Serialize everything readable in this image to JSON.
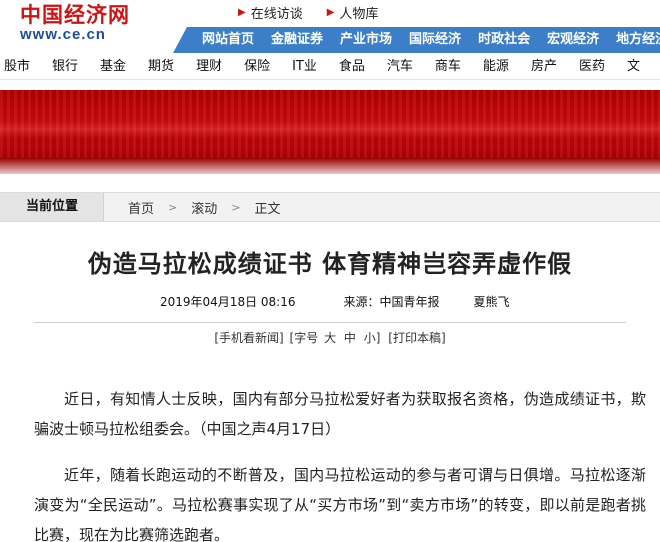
{
  "site": {
    "logo_cn": "中国经济网",
    "logo_url": "www.ce.cn"
  },
  "toplinks": [
    {
      "label": "在线访谈"
    },
    {
      "label": "人物库"
    }
  ],
  "channels": [
    "网站首页",
    "金融证券",
    "产业市场",
    "国际经济",
    "时政社会",
    "宏观经济",
    "地方经济"
  ],
  "categories": [
    "股市",
    "银行",
    "基金",
    "期货",
    "理财",
    "保险",
    "IT业",
    "食品",
    "汽车",
    "商车",
    "能源",
    "房产",
    "医药",
    "文"
  ],
  "breadcrumb": {
    "head": "当前位置",
    "items": [
      "首页",
      "滚动",
      "正文"
    ],
    "separator": ">"
  },
  "article": {
    "title": "伪造马拉松成绩证书  体育精神岂容弄虚作假",
    "date": "2019年04月18日  08:16",
    "source_label": "来源：",
    "source": "中国青年报",
    "author": "夏熊飞",
    "tools": {
      "mobile": "[手机看新闻]",
      "font_prefix": "[字号",
      "font_large": "大",
      "font_medium": "中",
      "font_small": "小]",
      "print": "[打印本稿]"
    },
    "paragraphs": [
      "近日，有知情人士反映，国内有部分马拉松爱好者为获取报名资格，伪造成绩证书，欺骗波士顿马拉松组委会。（中国之声4月17日）",
      "近年，随着长跑运动的不断普及，国内马拉松运动的参与者可谓与日俱增。马拉松逐渐演变为“全民运动”。马拉松赛事实现了从“买方市场”到“卖方市场”的转变，即以前是跑者挑比赛，现在为比赛筛选跑者。"
    ]
  },
  "colors": {
    "brand_red": "#d21111",
    "channel_blue": "#3c7fc8",
    "url_blue": "#1b4f9b"
  }
}
